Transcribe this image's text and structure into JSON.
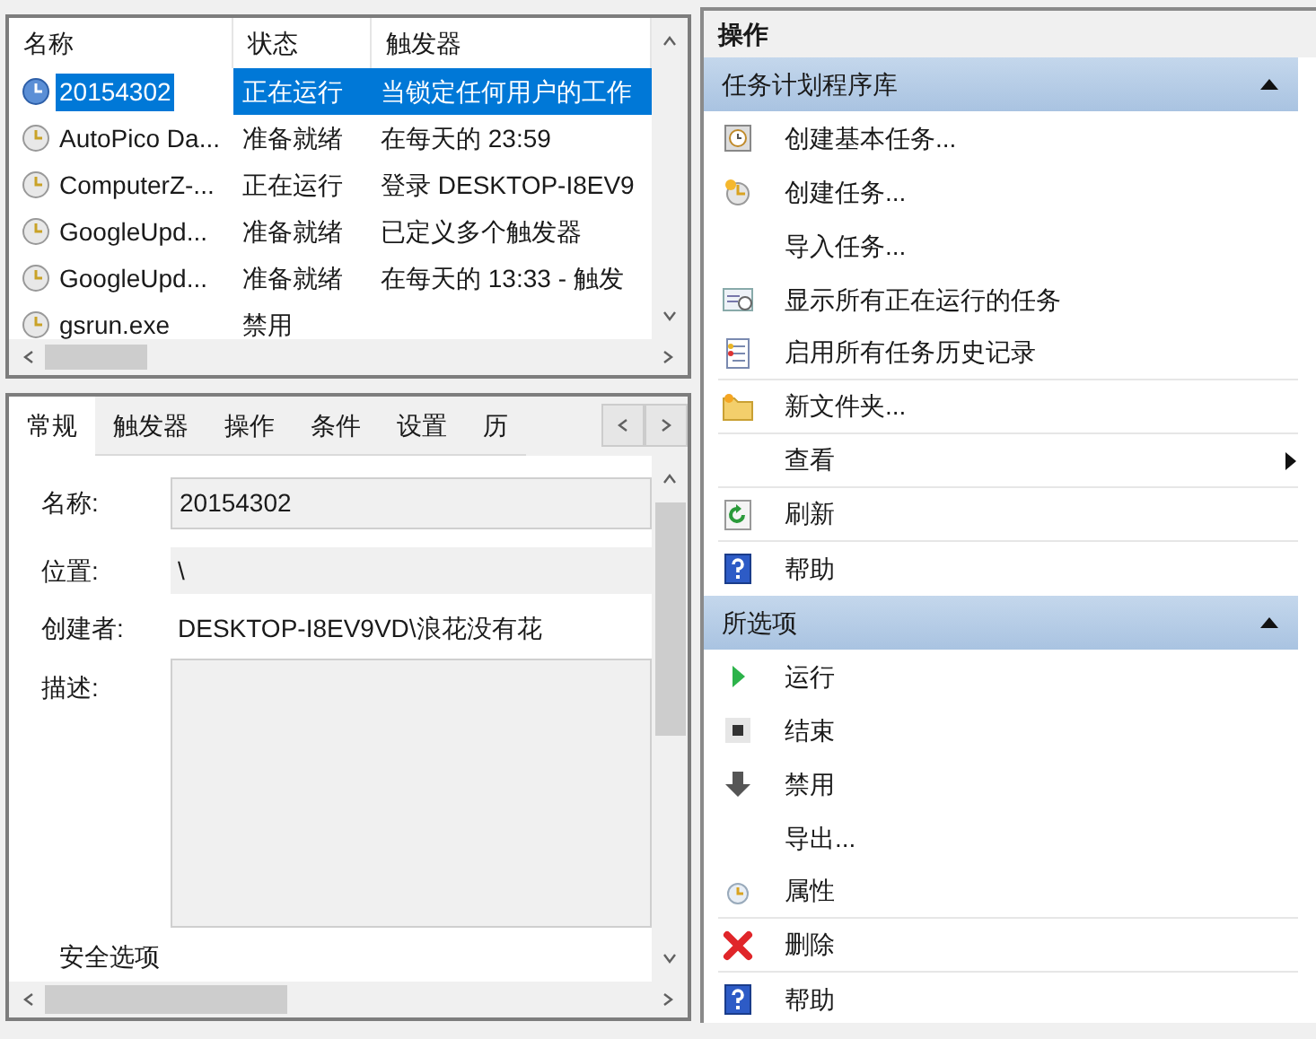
{
  "task_list": {
    "columns": [
      "名称",
      "状态",
      "触发器"
    ],
    "rows": [
      {
        "name": "20154302",
        "status": "正在运行",
        "trigger": "当锁定任何用户的工作",
        "selected": true
      },
      {
        "name": "AutoPico Da...",
        "status": "准备就绪",
        "trigger": "在每天的 23:59",
        "selected": false
      },
      {
        "name": "ComputerZ-...",
        "status": "正在运行",
        "trigger": "登录 DESKTOP-I8EV9",
        "selected": false
      },
      {
        "name": "GoogleUpd...",
        "status": "准备就绪",
        "trigger": "已定义多个触发器",
        "selected": false
      },
      {
        "name": "GoogleUpd...",
        "status": "准备就绪",
        "trigger": "在每天的 13:33 - 触发",
        "selected": false
      },
      {
        "name": "gsrun.exe",
        "status": "禁用",
        "trigger": "",
        "selected": false
      }
    ]
  },
  "details": {
    "tabs": [
      {
        "label": "常规",
        "selected": true
      },
      {
        "label": "触发器",
        "selected": false
      },
      {
        "label": "操作",
        "selected": false
      },
      {
        "label": "条件",
        "selected": false
      },
      {
        "label": "设置",
        "selected": false
      },
      {
        "label": "历",
        "selected": false
      }
    ],
    "name_label": "名称:",
    "name_value": "20154302",
    "location_label": "位置:",
    "location_value": "\\",
    "author_label": "创建者:",
    "author_value": "DESKTOP-I8EV9VD\\浪花没有花",
    "description_label": "描述:",
    "security_label": "安全选项"
  },
  "actions": {
    "title": "操作",
    "sections": [
      {
        "title": "任务计划程序库",
        "expanded": true,
        "items": [
          {
            "label": "创建基本任务...",
            "separated": false,
            "has_submenu": false
          },
          {
            "label": "创建任务...",
            "separated": false,
            "has_submenu": false
          },
          {
            "label": "导入任务...",
            "separated": false,
            "has_submenu": false
          },
          {
            "label": "显示所有正在运行的任务",
            "separated": false,
            "has_submenu": false
          },
          {
            "label": "启用所有任务历史记录",
            "separated": true,
            "has_submenu": false
          },
          {
            "label": "新文件夹...",
            "separated": true,
            "has_submenu": false
          },
          {
            "label": "查看",
            "separated": true,
            "has_submenu": true
          },
          {
            "label": "刷新",
            "separated": true,
            "has_submenu": false
          },
          {
            "label": "帮助",
            "separated": false,
            "has_submenu": false
          }
        ]
      },
      {
        "title": "所选项",
        "expanded": true,
        "items": [
          {
            "label": "运行",
            "separated": false,
            "has_submenu": false
          },
          {
            "label": "结束",
            "separated": false,
            "has_submenu": false
          },
          {
            "label": "禁用",
            "separated": false,
            "has_submenu": false
          },
          {
            "label": "导出...",
            "separated": false,
            "has_submenu": false
          },
          {
            "label": "属性",
            "separated": true,
            "has_submenu": false
          },
          {
            "label": "删除",
            "separated": true,
            "has_submenu": false
          },
          {
            "label": "帮助",
            "separated": false,
            "has_submenu": false
          }
        ]
      }
    ]
  }
}
